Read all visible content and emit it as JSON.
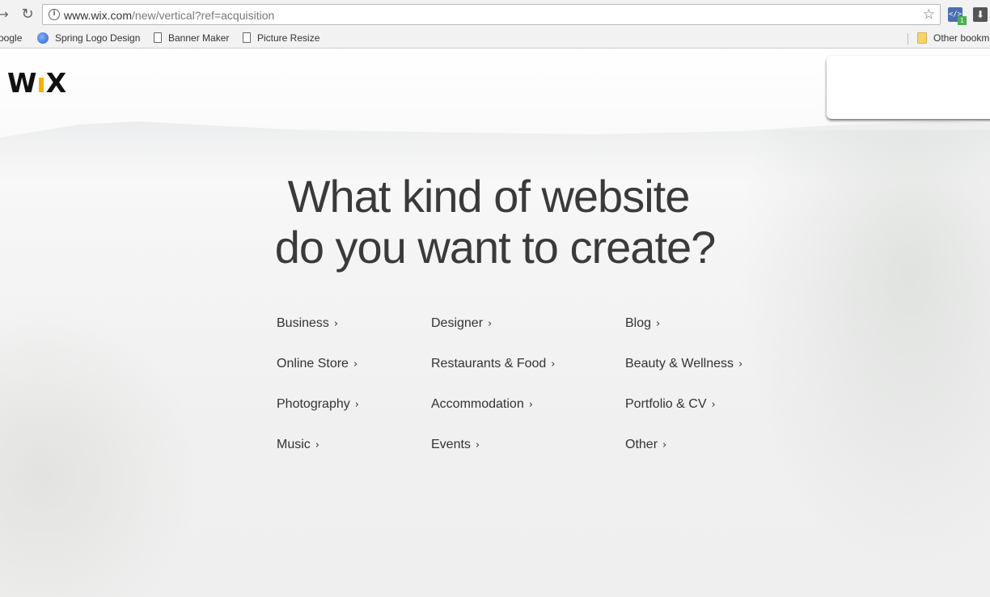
{
  "browser": {
    "url_host": "www.wix.com",
    "url_path": "/new/vertical?ref=acquisition",
    "bookmarks": [
      {
        "label": "oogle"
      },
      {
        "label": "Spring Logo Design"
      },
      {
        "label": "Banner Maker"
      },
      {
        "label": "Picture Resize"
      }
    ],
    "other_bookmarks": "Other bookm",
    "extension_badge": "1"
  },
  "page": {
    "logo": "WIX",
    "headline_line1": "What kind of website",
    "headline_line2": "do you want to create?",
    "categories": [
      [
        "Business",
        "Designer",
        "Blog"
      ],
      [
        "Online Store",
        "Restaurants & Food",
        "Beauty & Wellness"
      ],
      [
        "Photography",
        "Accommodation",
        "Portfolio & CV"
      ],
      [
        "Music",
        "Events",
        "Other"
      ]
    ],
    "chevron": "›"
  },
  "colors": {
    "logo_dot": "#f2b100",
    "text": "#333333"
  }
}
